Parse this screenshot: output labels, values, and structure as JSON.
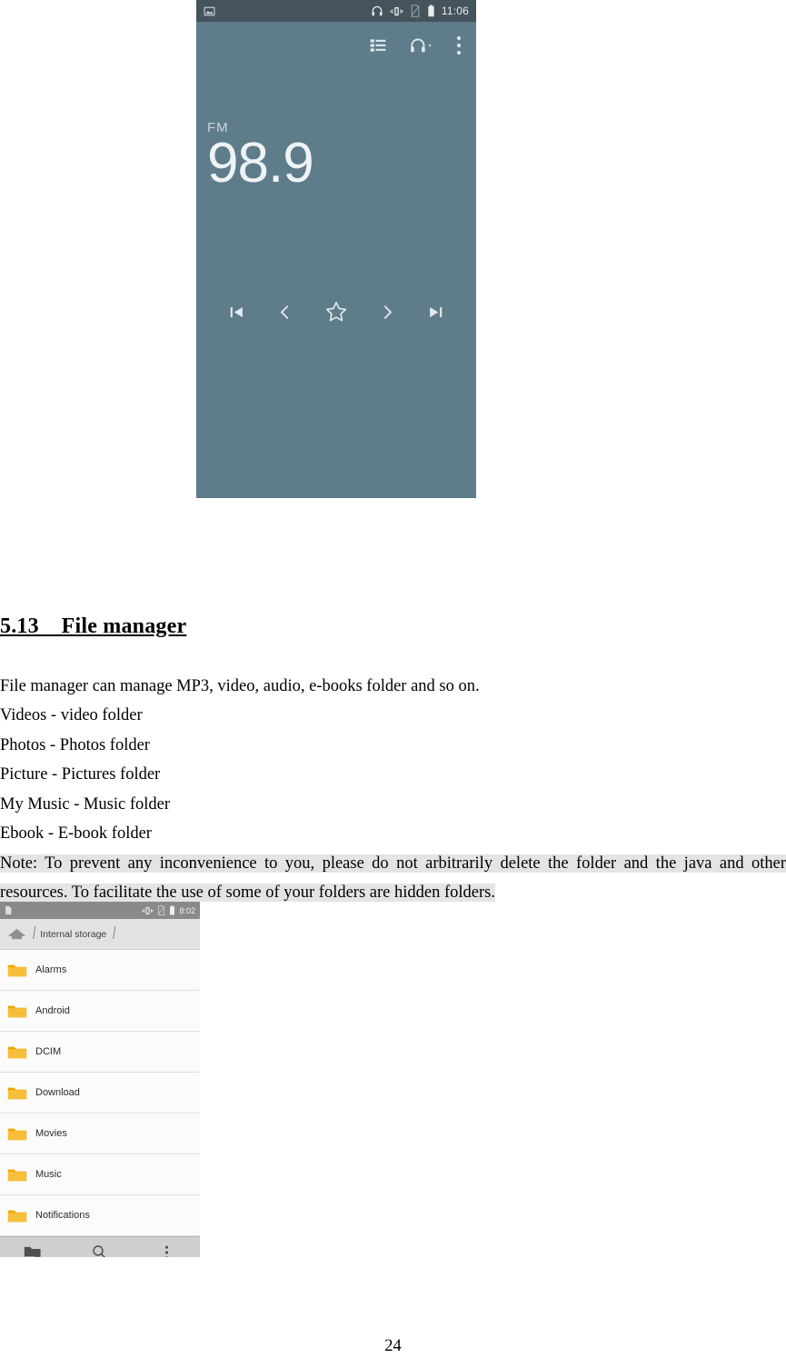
{
  "fm_radio_screenshot": {
    "status_bar": {
      "left_icons": [
        "image-icon"
      ],
      "right_icons": [
        "headphone-icon",
        "vibrate-icon",
        "sim-off-icon",
        "battery-icon"
      ],
      "time": "11:06"
    },
    "toolbar": {
      "icons": [
        "station-list-icon",
        "headphone-output-dropdown-icon",
        "overflow-menu-icon"
      ]
    },
    "band_label": "FM",
    "frequency": "98.9",
    "controls": [
      {
        "name": "skip-previous-icon",
        "label": "Previous station"
      },
      {
        "name": "tune-down-icon",
        "label": "Tune down"
      },
      {
        "name": "favorite-star-icon",
        "label": "Favorite"
      },
      {
        "name": "tune-up-icon",
        "label": "Tune up"
      },
      {
        "name": "skip-next-icon",
        "label": "Next station"
      }
    ],
    "fab": {
      "name": "stop-button",
      "icon": "stop-square-icon",
      "color": "#f73a72"
    },
    "colors": {
      "background": "#5f7c8a",
      "status_bar": "#44535c",
      "accent": "#f73a72"
    }
  },
  "document": {
    "heading": "5.13    File manager",
    "paragraphs": [
      "File manager can manage MP3, video, audio, e-books folder and so on.",
      "Videos - video folder",
      "Photos - Photos folder",
      "Picture - Pictures folder",
      "My Music - Music folder",
      "Ebook - E-book folder"
    ],
    "note": "Note: To prevent any inconvenience to you, please do not arbitrarily delete the folder and the java and other resources. To facilitate the use of some of your folders are hidden folders.",
    "note_highlight_color": "#e4e4e4",
    "page_number": "24"
  },
  "file_manager_screenshot": {
    "status_bar": {
      "left_icons": [
        "sim-card-icon"
      ],
      "right_icons": [
        "vibrate-icon",
        "sim-off-icon",
        "battery-icon"
      ],
      "time": "8:02"
    },
    "breadcrumb": {
      "home_icon": "home-icon",
      "path": "Internal storage"
    },
    "folders": [
      {
        "icon": "folder-icon",
        "name": "Alarms"
      },
      {
        "icon": "folder-icon",
        "name": "Android"
      },
      {
        "icon": "folder-icon",
        "name": "DCIM"
      },
      {
        "icon": "folder-icon",
        "name": "Download"
      },
      {
        "icon": "folder-icon",
        "name": "Movies"
      },
      {
        "icon": "folder-icon",
        "name": "Music"
      },
      {
        "icon": "folder-icon",
        "name": "Notifications"
      }
    ],
    "bottom_bar": {
      "icons": [
        "new-folder-icon",
        "search-icon",
        "overflow-menu-icon"
      ]
    },
    "colors": {
      "folder": "#f5b324",
      "status_bar": "#8a8a8a",
      "toolbar": "#e2e2e2"
    }
  }
}
